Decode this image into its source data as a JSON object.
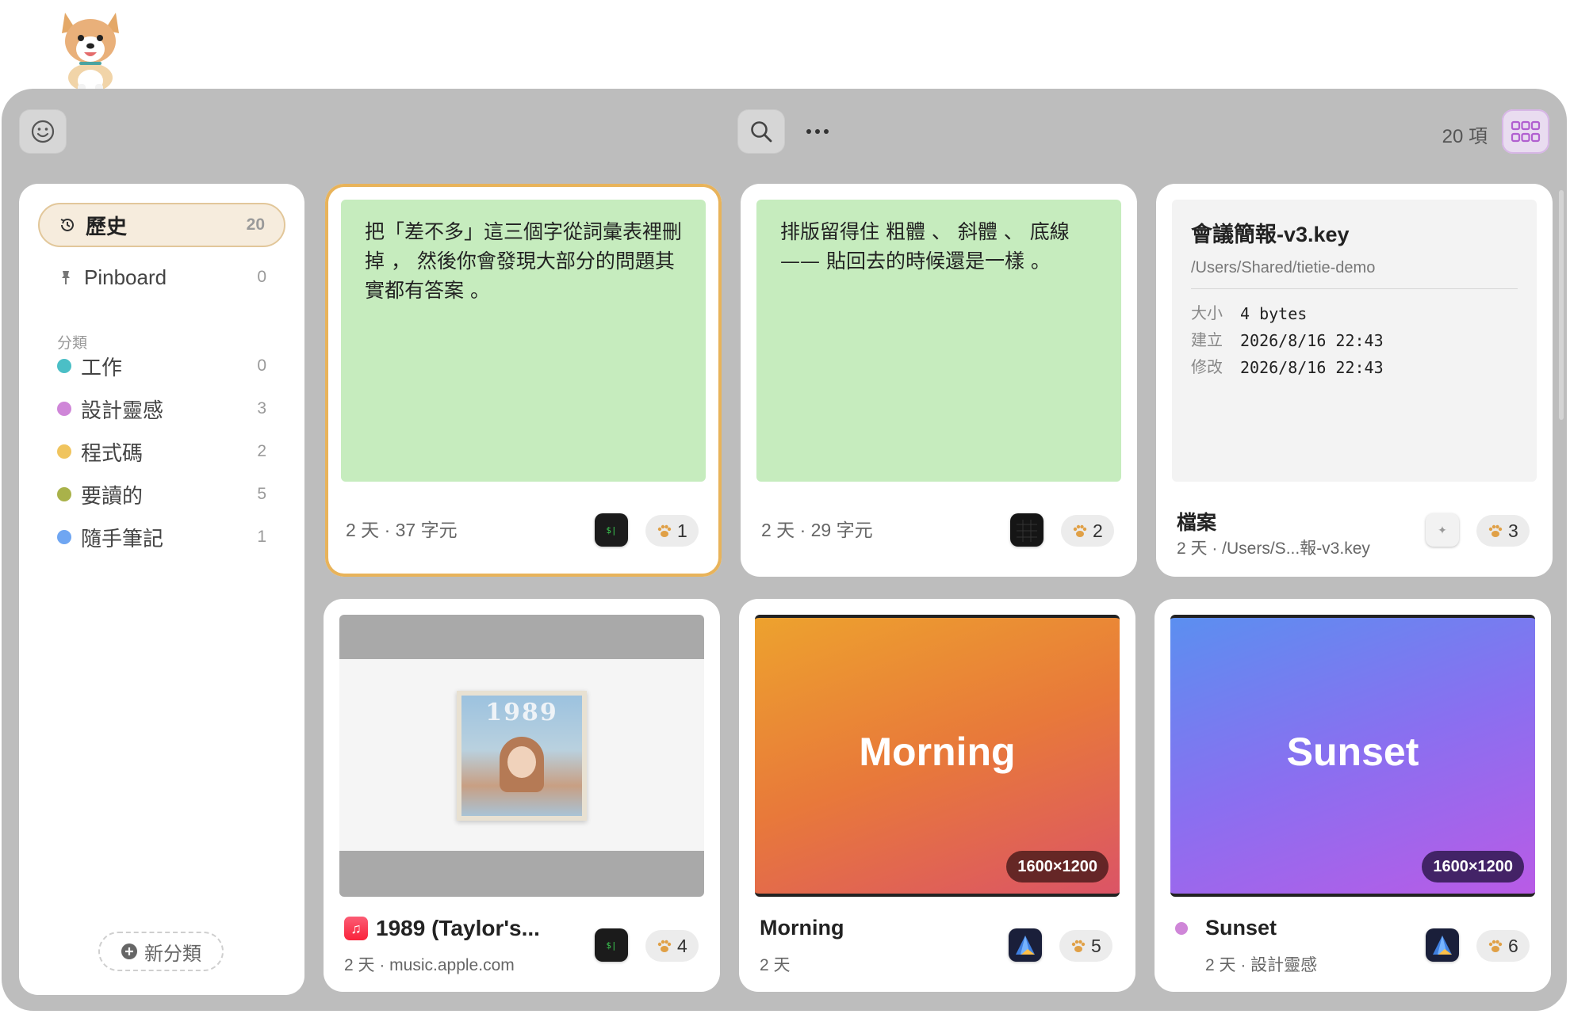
{
  "toolbar": {
    "item_count": "20 項"
  },
  "sidebar": {
    "history": {
      "label": "歷史",
      "count": "20"
    },
    "pinboard": {
      "label": "Pinboard",
      "count": "0"
    },
    "section_title": "分類",
    "categories": [
      {
        "label": "工作",
        "count": "0",
        "color": "#4bbfc6"
      },
      {
        "label": "設計靈感",
        "count": "3",
        "color": "#cf86d8"
      },
      {
        "label": "程式碼",
        "count": "2",
        "color": "#f0c45e"
      },
      {
        "label": "要讀的",
        "count": "5",
        "color": "#a9b24a"
      },
      {
        "label": "隨手筆記",
        "count": "1",
        "color": "#6fa6f2"
      }
    ],
    "new_category": "新分類"
  },
  "cards": [
    {
      "text": "把「差不多」這三個字從詞彙表裡刪掉 ， 然後你會發現大部分的問題其實都有答案 。",
      "meta": "2 天 · 37 字元",
      "badge": "1"
    },
    {
      "text": "排版留得住 粗體 、 斜體 、 底線 —— 貼回去的時候還是一樣 。",
      "meta": "2 天 · 29 字元",
      "badge": "2"
    },
    {
      "file_name": "會議簡報-v3.key",
      "file_path": "/Users/Shared/tietie-demo",
      "rows": [
        {
          "k": "大小",
          "v": "4 bytes"
        },
        {
          "k": "建立",
          "v": "2026/8/16 22:43"
        },
        {
          "k": "修改",
          "v": "2026/8/16 22:43"
        }
      ],
      "title": "檔案",
      "meta": "2 天 · /Users/S...報-v3.key",
      "badge": "3"
    },
    {
      "album_text": "1989",
      "title": "1989 (Taylor's...",
      "meta": "2 天 · music.apple.com",
      "badge": "4"
    },
    {
      "image_label": "Morning",
      "dims": "1600×1200",
      "title": "Morning",
      "meta": "2 天",
      "badge": "5"
    },
    {
      "image_label": "Sunset",
      "dims": "1600×1200",
      "title": "Sunset",
      "meta": "2 天 · 設計靈感",
      "badge": "6"
    }
  ]
}
